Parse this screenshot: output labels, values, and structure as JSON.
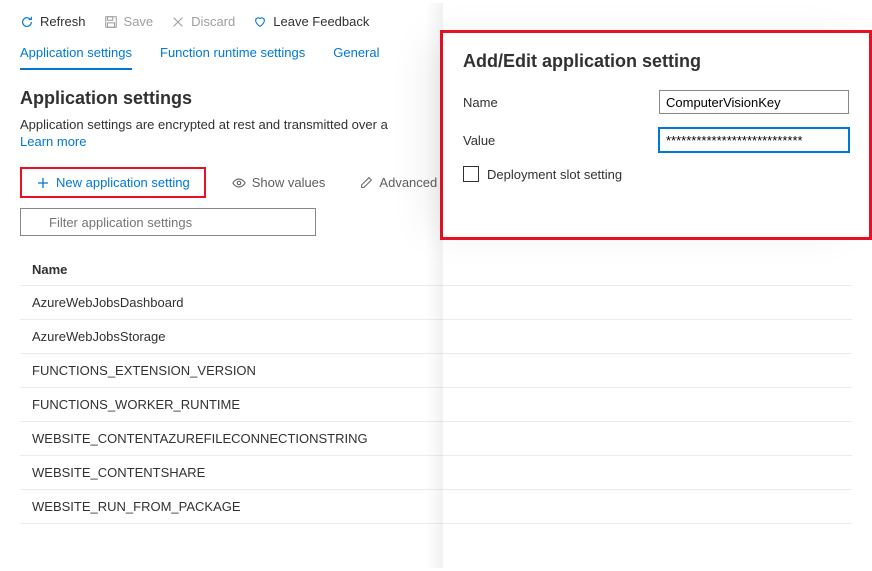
{
  "toolbar": {
    "refresh": "Refresh",
    "save": "Save",
    "discard": "Discard",
    "feedback": "Leave Feedback"
  },
  "tabs": {
    "items": [
      {
        "label": "Application settings",
        "active": true
      },
      {
        "label": "Function runtime settings",
        "active": false
      },
      {
        "label": "General",
        "active": false
      }
    ]
  },
  "page": {
    "title": "Application settings",
    "description": "Application settings are encrypted at rest and transmitted over a",
    "learn_more": "Learn more"
  },
  "actions": {
    "new_setting": "New application setting",
    "show_values": "Show values",
    "advanced": "Advanced"
  },
  "filter": {
    "placeholder": "Filter application settings"
  },
  "table": {
    "header": "Name",
    "rows": [
      "AzureWebJobsDashboard",
      "AzureWebJobsStorage",
      "FUNCTIONS_EXTENSION_VERSION",
      "FUNCTIONS_WORKER_RUNTIME",
      "WEBSITE_CONTENTAZUREFILECONNECTIONSTRING",
      "WEBSITE_CONTENTSHARE",
      "WEBSITE_RUN_FROM_PACKAGE"
    ]
  },
  "panel": {
    "title": "Add/Edit application setting",
    "name_label": "Name",
    "name_value": "ComputerVisionKey",
    "value_label": "Value",
    "value_value": "***************************",
    "slot_label": "Deployment slot setting"
  }
}
